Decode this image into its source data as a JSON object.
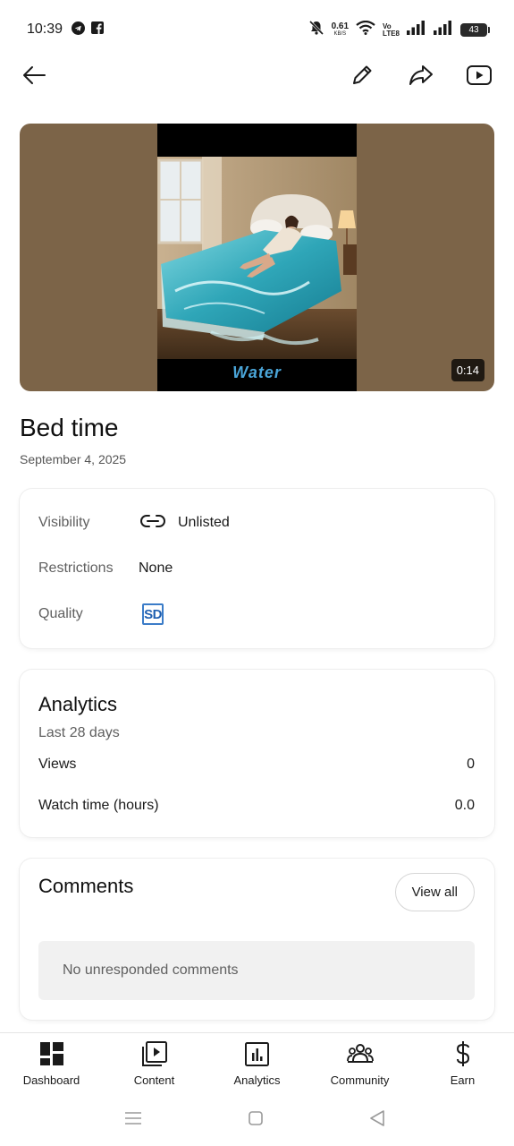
{
  "status_bar": {
    "time": "10:39",
    "net_speed": "0.61",
    "net_unit": "KB/S",
    "volte_top": "Vo",
    "volte_bottom": "LTE8",
    "battery": "43"
  },
  "video": {
    "duration": "0:14",
    "watermark": "Water",
    "title": "Bed time",
    "date": "September 4, 2025"
  },
  "details": {
    "visibility_label": "Visibility",
    "visibility_value": "Unlisted",
    "restrictions_label": "Restrictions",
    "restrictions_value": "None",
    "quality_label": "Quality",
    "quality_value": "SD"
  },
  "analytics": {
    "title": "Analytics",
    "period": "Last 28 days",
    "views_label": "Views",
    "views_value": "0",
    "watch_time_label": "Watch time (hours)",
    "watch_time_value": "0.0"
  },
  "comments": {
    "title": "Comments",
    "view_all": "View all",
    "empty_message": "No unresponded comments"
  },
  "bottom_nav": {
    "dashboard": "Dashboard",
    "content": "Content",
    "analytics": "Analytics",
    "community": "Community",
    "earn": "Earn"
  },
  "icons": {
    "back": "arrow-left-icon",
    "edit": "pencil-icon",
    "share": "share-icon",
    "youtube": "youtube-icon"
  }
}
